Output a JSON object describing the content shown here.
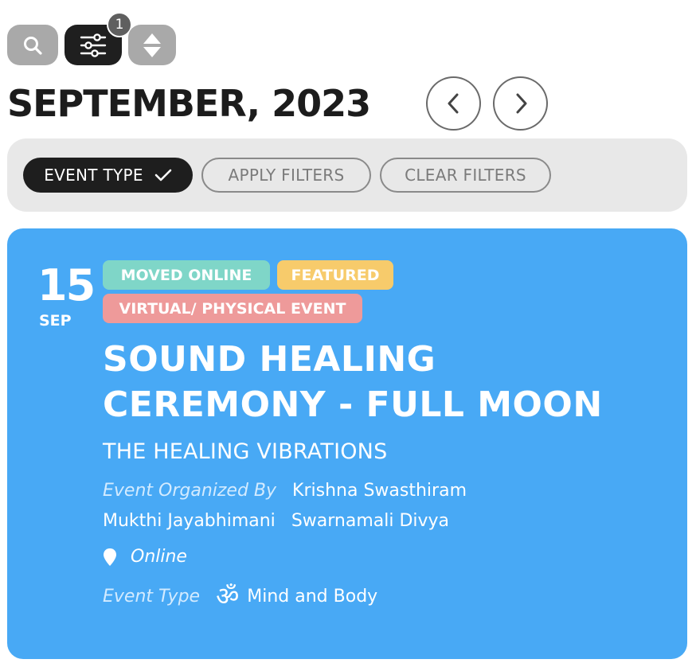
{
  "toolbar": {
    "search_icon": "search-icon",
    "filter_icon": "sliders-icon",
    "filter_count": "1",
    "sort_icon": "sort-icon"
  },
  "header": {
    "month_title": "SEPTEMBER, 2023",
    "prev_icon": "chevron-left-icon",
    "next_icon": "chevron-right-icon"
  },
  "filters": {
    "event_type_label": "EVENT TYPE",
    "apply_label": "APPLY FILTERS",
    "clear_label": "CLEAR FILTERS"
  },
  "event": {
    "day": "15",
    "month": "SEP",
    "tags": [
      "MOVED ONLINE",
      "FEATURED",
      "VIRTUAL/ PHYSICAL EVENT"
    ],
    "title": "SOUND HEALING CEREMONY - FULL MOON",
    "subtitle": "THE HEALING VIBRATIONS",
    "organized_by_label": "Event Organized By",
    "organizers": [
      "Krishna Swasthiram",
      "Mukthi Jayabhimani",
      "Swarnamali Divya"
    ],
    "location": "Online",
    "event_type_label": "Event Type",
    "event_type": "Mind and Body"
  },
  "colors": {
    "card_bg": "#48a9f5",
    "tag_online": "#7fd6c8",
    "tag_featured": "#f7cb6b",
    "tag_virtual": "#ee9a9a",
    "dark": "#1f1f1f"
  }
}
